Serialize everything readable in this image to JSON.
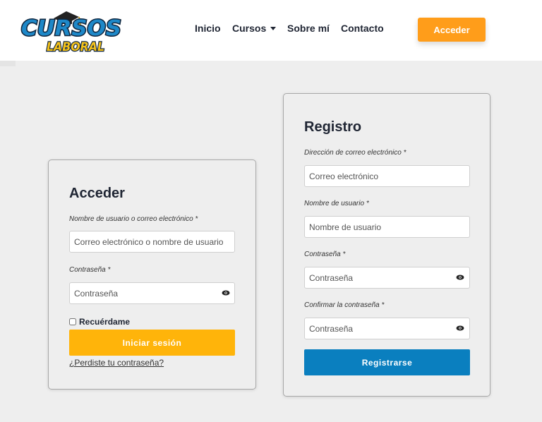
{
  "header": {
    "logo_top": "CURSOS",
    "logo_bottom": "LABORAL",
    "nav": [
      {
        "label": "Inicio"
      },
      {
        "label": "Cursos"
      },
      {
        "label": "Sobre mí"
      },
      {
        "label": "Contacto"
      }
    ],
    "acceder_button": "Acceder",
    "colors": {
      "accent": "#ff9d1a"
    }
  },
  "login": {
    "title": "Acceder",
    "username_label": "Nombre de usuario o correo electrónico *",
    "username_placeholder": "Correo electrónico o nombre de usuario",
    "password_label": "Contraseña *",
    "password_placeholder": "Contraseña",
    "remember_label": "Recuérdame",
    "submit_label": "Iniciar sesión",
    "lost_password_link": "¿Perdiste tu contraseña?",
    "colors": {
      "button": "#ffb40a"
    }
  },
  "register": {
    "title": "Registro",
    "email_label": "Dirección de correo electrónico *",
    "email_placeholder": "Correo electrónico",
    "username_label": "Nombre de usuario *",
    "username_placeholder": "Nombre de usuario",
    "password_label": "Contraseña *",
    "password_placeholder": "Contraseña",
    "confirm_label": "Confirmar la contraseña *",
    "confirm_placeholder": "Contraseña",
    "submit_label": "Registrarse",
    "colors": {
      "button": "#0a7fbf"
    }
  }
}
